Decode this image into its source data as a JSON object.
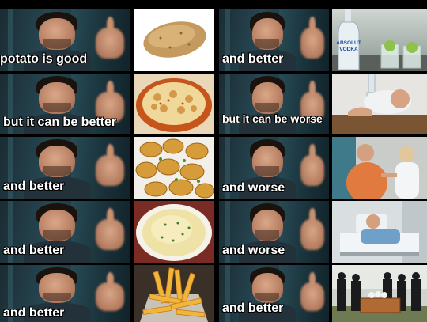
{
  "meme": {
    "rows": [
      {
        "left_caption": "potato is good",
        "image": "potato-icon",
        "right_caption": "and better",
        "right_image": "vodka-bottle-icon"
      },
      {
        "left_caption": "but it can be better",
        "image": "potato-gratin-icon",
        "right_caption": "but it can be worse",
        "right_image": "drunk-man-icon"
      },
      {
        "left_caption": "and better",
        "image": "fried-potatoes-icon",
        "right_caption": "and worse",
        "right_image": "doctor-patient-icon"
      },
      {
        "left_caption": "and better",
        "image": "mashed-potatoes-icon",
        "right_caption": "and worse",
        "right_image": "hospital-bed-icon"
      },
      {
        "left_caption": "and better",
        "image": "french-fries-icon",
        "right_caption": "and better",
        "right_image": "funeral-casket-icon"
      }
    ],
    "vodka_label": "ABSOLUT VODKA",
    "colors": {
      "background": "#000000",
      "caption_text": "#ffffff",
      "caption_outline": "#000000"
    }
  }
}
